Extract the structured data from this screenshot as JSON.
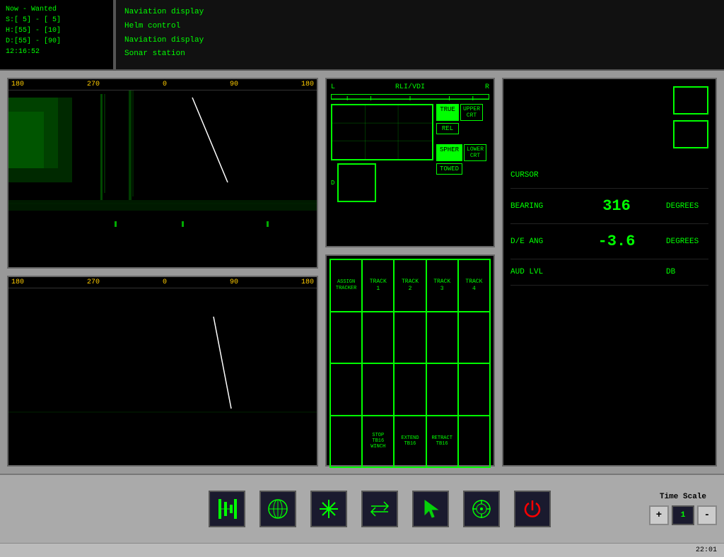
{
  "topbar": {
    "status_lines": [
      "Now - Wanted",
      "S:[ 5] - [ 5]",
      "H:[55] - [10]",
      "D:[55] - [90]",
      "  12:16:52"
    ],
    "menu_items": [
      "Naviation display",
      "Helm control",
      "Naviation display",
      "Sonar station"
    ]
  },
  "sonar_top": {
    "scale": [
      "180",
      "270",
      "0",
      "90",
      "180"
    ]
  },
  "sonar_bottom": {
    "scale": [
      "180",
      "270",
      "0",
      "90",
      "180"
    ]
  },
  "rli": {
    "title": "RLI/VDI",
    "left_label": "L",
    "right_label": "R",
    "bottom_label": "D",
    "buttons": {
      "true_btn": "TRUE",
      "rel_btn": "REL",
      "spher_btn": "SPHER",
      "towed_btn": "TOWED",
      "upper_crt": "UPPER CRT",
      "lower_crt": "LOWER CRT"
    }
  },
  "tracker": {
    "cells": [
      {
        "label": "ASSIGN\nTRACKER",
        "col": 0,
        "row": 0
      },
      {
        "label": "TRACK\n1",
        "col": 1,
        "row": 0
      },
      {
        "label": "TRACK\n2",
        "col": 2,
        "row": 0
      },
      {
        "label": "TRACK\n3",
        "col": 3,
        "row": 0
      },
      {
        "label": "TRACK\n4",
        "col": 4,
        "row": 0
      }
    ],
    "bottom_row": [
      {
        "label": "STOP\nTB16\nWINCH"
      },
      {
        "label": "EXTEND\nTB16"
      },
      {
        "label": "RETRACT\nTB16"
      }
    ]
  },
  "data_panel": {
    "cursor_label": "CURSOR",
    "bearing_label": "BEARING",
    "bearing_value": "316",
    "bearing_unit": "DEGREES",
    "de_ang_label": "D/E ANG",
    "de_ang_value": "-3.6",
    "de_ang_unit": "DEGREES",
    "aud_lvl_label": "AUD LVL",
    "aud_lvl_unit": "DB"
  },
  "toolbar": {
    "icons": [
      {
        "name": "waveform-icon",
        "symbol": ""
      },
      {
        "name": "globe-icon",
        "symbol": ""
      },
      {
        "name": "signal-icon",
        "symbol": ""
      },
      {
        "name": "exchange-icon",
        "symbol": ""
      },
      {
        "name": "cursor-icon",
        "symbol": ""
      },
      {
        "name": "target-icon",
        "symbol": ""
      },
      {
        "name": "power-icon",
        "symbol": ""
      }
    ],
    "time_scale_label": "Time Scale",
    "time_scale_minus": "-",
    "time_scale_plus": "+",
    "time_scale_value": "1"
  },
  "statusbar": {
    "clock": "22:01"
  }
}
